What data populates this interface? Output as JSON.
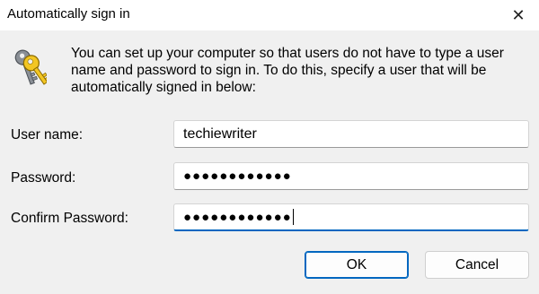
{
  "window": {
    "title": "Automatically sign in",
    "close_glyph": "✕"
  },
  "icon": {
    "name": "keys-icon",
    "accent": "#f3c623"
  },
  "description": "You can set up your computer so that users do not have to type a user name and password to sign in. To do this, specify a user that will be automatically signed in below:",
  "form": {
    "username_label": "User name:",
    "username_value": "techiewriter",
    "password_label": "Password:",
    "password_value": "●●●●●●●●●●●●",
    "confirm_label": "Confirm Password:",
    "confirm_value": "●●●●●●●●●●●●"
  },
  "buttons": {
    "ok": "OK",
    "cancel": "Cancel"
  },
  "colors": {
    "accent": "#0067c0",
    "background": "#f0f0f0"
  }
}
